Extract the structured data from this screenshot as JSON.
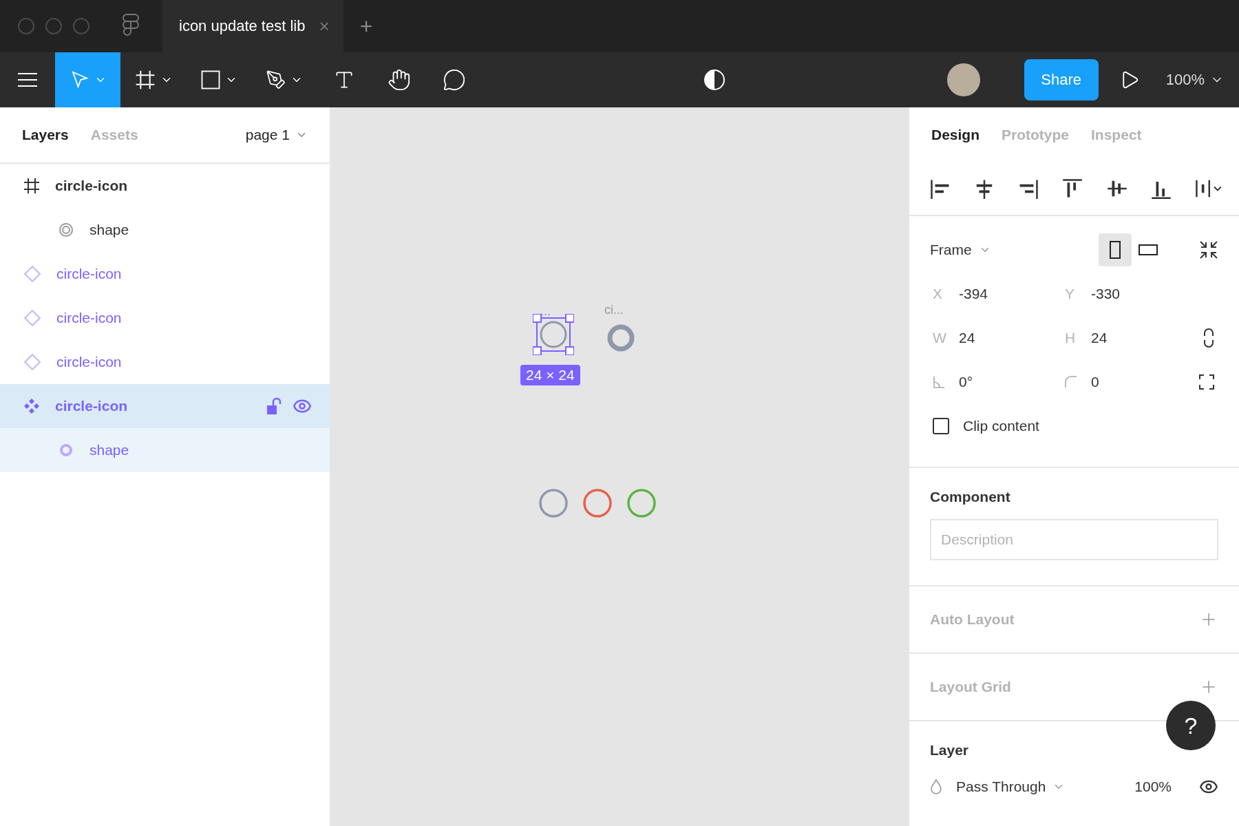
{
  "window": {
    "tab_title": "icon update test lib",
    "tab_close": "×",
    "new_tab": "+"
  },
  "toolbar": {
    "tools": [
      {
        "kind": "move",
        "selected": true,
        "dropdown": true
      },
      {
        "kind": "frame",
        "selected": false,
        "dropdown": true
      },
      {
        "kind": "rectangle",
        "selected": false,
        "dropdown": true
      },
      {
        "kind": "pen",
        "selected": false,
        "dropdown": true
      },
      {
        "kind": "text",
        "selected": false,
        "dropdown": false
      },
      {
        "kind": "hand",
        "selected": false,
        "dropdown": false
      },
      {
        "kind": "comment",
        "selected": false,
        "dropdown": false
      }
    ],
    "share": "Share",
    "zoom": "100%"
  },
  "layers_panel": {
    "tabs": [
      {
        "label": "Layers",
        "selected": true
      },
      {
        "label": "Assets",
        "selected": false
      }
    ],
    "page": "page 1",
    "layers": [
      {
        "kind": "frame",
        "name": "circle-icon",
        "selected": false,
        "children": [
          {
            "kind": "ellipse",
            "name": "shape",
            "selected": false
          }
        ]
      },
      {
        "kind": "instance",
        "name": "circle-icon",
        "selected": false
      },
      {
        "kind": "instance",
        "name": "circle-icon",
        "selected": false
      },
      {
        "kind": "instance",
        "name": "circle-icon",
        "selected": false
      },
      {
        "kind": "component",
        "name": "circle-icon",
        "selected": true,
        "children": [
          {
            "kind": "ellipse",
            "name": "shape",
            "selected": false
          }
        ]
      }
    ]
  },
  "canvas": {
    "selected_label": "...",
    "selection_size": "24 × 24",
    "instance_label": "ci...",
    "circles": [
      {
        "color": "#8f98ab"
      },
      {
        "color": "#e8604c"
      },
      {
        "color": "#5db345"
      }
    ]
  },
  "design_panel": {
    "tabs": [
      {
        "label": "Design",
        "selected": true
      },
      {
        "label": "Prototype",
        "selected": false
      },
      {
        "label": "Inspect",
        "selected": false
      }
    ],
    "frame": {
      "preset": "Frame",
      "orientation": [
        {
          "kind": "portrait",
          "selected": true
        },
        {
          "kind": "landscape",
          "selected": false
        }
      ],
      "fields": [
        {
          "kind": "label",
          "label": "X",
          "value": "-394"
        },
        {
          "kind": "label",
          "label": "Y",
          "value": "-330"
        },
        {
          "kind": "label",
          "label": "W",
          "value": "24"
        },
        {
          "kind": "label",
          "label": "H",
          "value": "24"
        },
        {
          "kind": "rotation",
          "value": "0°"
        },
        {
          "kind": "radius",
          "value": "0"
        }
      ],
      "clip_content": {
        "label": "Clip content",
        "checked": false
      }
    },
    "component": {
      "title": "Component",
      "placeholder": "Description"
    },
    "sections": [
      {
        "title": "Auto Layout"
      },
      {
        "title": "Layout Grid"
      }
    ],
    "layer": {
      "title": "Layer",
      "blend": "Pass Through",
      "opacity": "100%"
    },
    "help": "?"
  }
}
